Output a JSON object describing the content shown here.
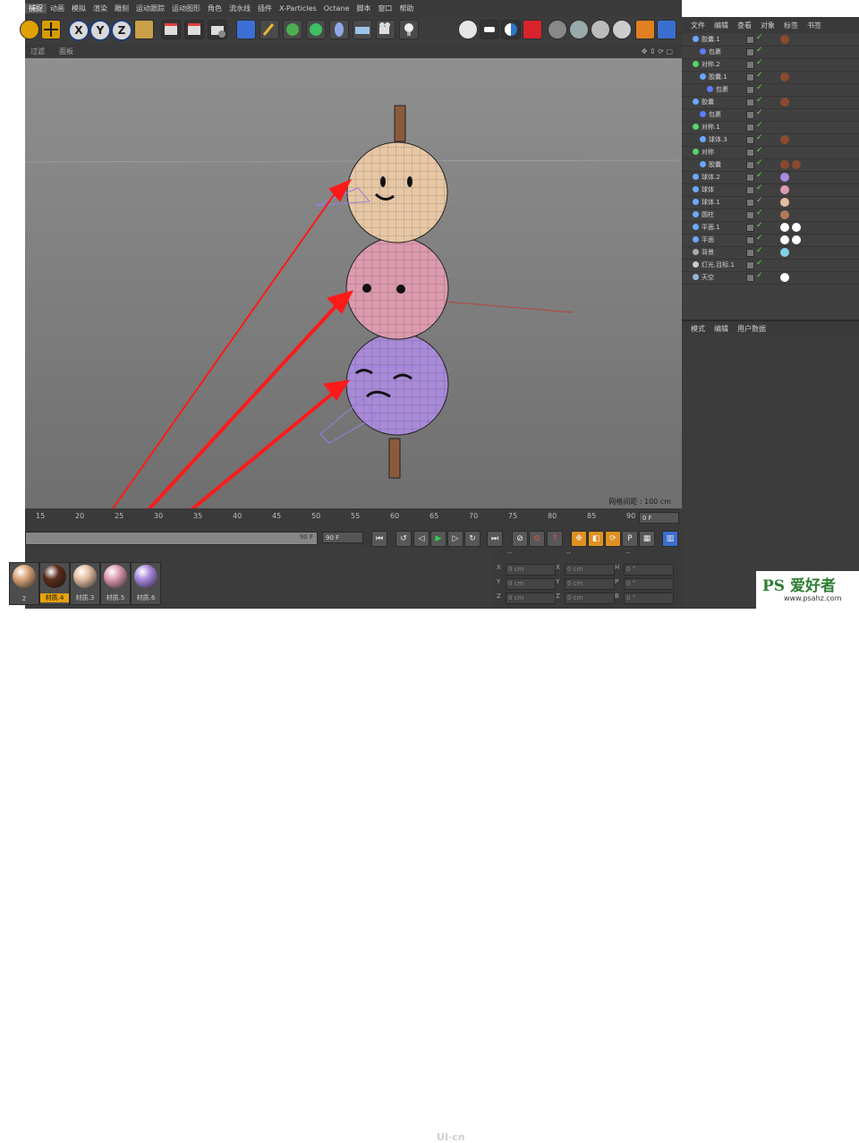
{
  "menubar": {
    "items": [
      "捕捉",
      "动画",
      "模拟",
      "渲染",
      "雕刻",
      "运动跟踪",
      "运动图形",
      "角色",
      "流水线",
      "插件",
      "X-Particles",
      "Octane",
      "脚本",
      "窗口",
      "帮助"
    ],
    "active": "捕捉"
  },
  "toolbar": {
    "axes": [
      "X",
      "Y",
      "Z"
    ]
  },
  "viewport": {
    "tabs": [
      "过滤",
      "面板"
    ],
    "grid_label": "网格间距 : 100 cm"
  },
  "timeline": {
    "ticks": [
      "15",
      "20",
      "25",
      "30",
      "35",
      "40",
      "45",
      "50",
      "55",
      "60",
      "65",
      "70",
      "75",
      "80",
      "85",
      "90"
    ],
    "frame_field": "0 F",
    "scrub_end": "90 F",
    "end_field": "90 F"
  },
  "materials": [
    {
      "label": "2",
      "color": "#d9a57a",
      "selected": false
    },
    {
      "label": "材质.4",
      "color": "#5b2c1c",
      "selected": true
    },
    {
      "label": "材质.3",
      "color": "#e3bfa0",
      "selected": false
    },
    {
      "label": "材质.5",
      "color": "#dd9bb0",
      "selected": false
    },
    {
      "label": "材质.6",
      "color": "#a98ae0",
      "selected": false
    }
  ],
  "coords": {
    "dashes": [
      "--",
      "--",
      "--"
    ],
    "rows": [
      {
        "a": "X",
        "av": "0 cm",
        "b": "X",
        "bv": "0 cm",
        "c": "H",
        "cv": "0 °"
      },
      {
        "a": "Y",
        "av": "0 cm",
        "b": "Y",
        "bv": "0 cm",
        "c": "P",
        "cv": "0 °"
      },
      {
        "a": "Z",
        "av": "0 cm",
        "b": "Z",
        "bv": "0 cm",
        "c": "B",
        "cv": "0 °"
      }
    ]
  },
  "object_manager": {
    "tabs": [
      "文件",
      "编辑",
      "查看",
      "对象",
      "标签",
      "书签"
    ],
    "rows": [
      {
        "name": "胶囊.1",
        "indent": 0,
        "icon": "#6aa9ff",
        "tags": [
          "#8b4a2e"
        ]
      },
      {
        "name": "包裹",
        "indent": 1,
        "icon": "#5b7cff",
        "tags": []
      },
      {
        "name": "对称.2",
        "indent": 0,
        "icon": "#55d46a",
        "tags": []
      },
      {
        "name": "胶囊.1",
        "indent": 1,
        "icon": "#6aa9ff",
        "tags": [
          "#8b4a2e"
        ]
      },
      {
        "name": "包裹",
        "indent": 2,
        "icon": "#5b7cff",
        "tags": []
      },
      {
        "name": "胶囊",
        "indent": 0,
        "icon": "#6aa9ff",
        "tags": [
          "#8b4a2e"
        ]
      },
      {
        "name": "包裹",
        "indent": 1,
        "icon": "#5b7cff",
        "tags": []
      },
      {
        "name": "对称.1",
        "indent": 0,
        "icon": "#55d46a",
        "tags": []
      },
      {
        "name": "球体.3",
        "indent": 1,
        "icon": "#6aa9ff",
        "tags": [
          "#8b4a2e"
        ]
      },
      {
        "name": "对称",
        "indent": 0,
        "icon": "#55d46a",
        "tags": []
      },
      {
        "name": "胶囊",
        "indent": 1,
        "icon": "#6aa9ff",
        "tags": [
          "#8b4a2e",
          "#8b4a2e"
        ]
      },
      {
        "name": "球体.2",
        "indent": 0,
        "icon": "#6aa9ff",
        "tags": [
          "#a98ae0"
        ]
      },
      {
        "name": "球体",
        "indent": 0,
        "icon": "#6aa9ff",
        "tags": [
          "#dd9bb0"
        ]
      },
      {
        "name": "球体.1",
        "indent": 0,
        "icon": "#6aa9ff",
        "tags": [
          "#e3bfa0"
        ]
      },
      {
        "name": "圆柱",
        "indent": 0,
        "icon": "#6aa9ff",
        "tags": [
          "#b07a5a"
        ]
      },
      {
        "name": "平面.1",
        "indent": 0,
        "icon": "#6aa9ff",
        "tags": [
          "#ffffff",
          "#ffffff"
        ]
      },
      {
        "name": "平面",
        "indent": 0,
        "icon": "#6aa9ff",
        "tags": [
          "#ffffff",
          "#ffffff"
        ]
      },
      {
        "name": "背景",
        "indent": 0,
        "icon": "#aaaaaa",
        "tags": [
          "#7fd3e6"
        ]
      },
      {
        "name": "灯光.目标.1",
        "indent": 0,
        "icon": "#cccccc",
        "tags": []
      },
      {
        "name": "天空",
        "indent": 0,
        "icon": "#9ab4d8",
        "tags": [
          "#ffffff"
        ]
      }
    ]
  },
  "attributes": {
    "tabs": [
      "模式",
      "编辑",
      "用户数据"
    ]
  },
  "watermark": {
    "text": "PS 爱好者",
    "url": "www.psahz.com"
  },
  "logo": "UI·cn"
}
